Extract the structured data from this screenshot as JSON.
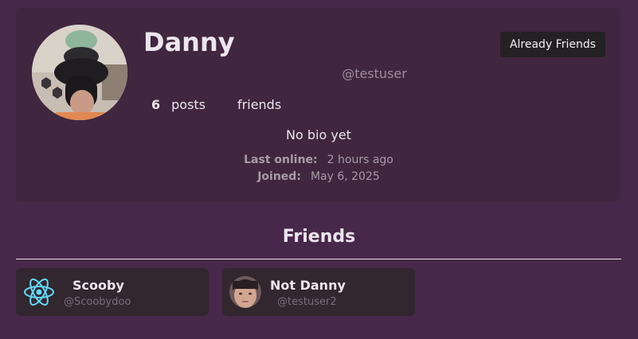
{
  "profile": {
    "name": "Danny",
    "username": "@testuser",
    "action_button": "Already Friends",
    "stats": {
      "posts_count": "6",
      "posts_label": "posts",
      "friends_label": "friends"
    },
    "bio": "No bio yet",
    "last_online_label": "Last online:",
    "last_online_value": "2 hours ago",
    "joined_label": "Joined:",
    "joined_value": "May 6, 2025",
    "avatar_icon": "user-photo-avatar"
  },
  "friends_section": {
    "title": "Friends",
    "items": [
      {
        "name": "Scooby",
        "handle": "@Scoobydoo",
        "avatar_icon": "react-atom-icon",
        "icon_color": "#61dafb"
      },
      {
        "name": "Not Danny",
        "handle": "@testuser2",
        "avatar_icon": "user-photo-avatar"
      }
    ]
  },
  "colors": {
    "page_background": "#48284a",
    "card_background": "#41263f",
    "friend_card_background": "#32262f",
    "button_background": "#242124"
  }
}
